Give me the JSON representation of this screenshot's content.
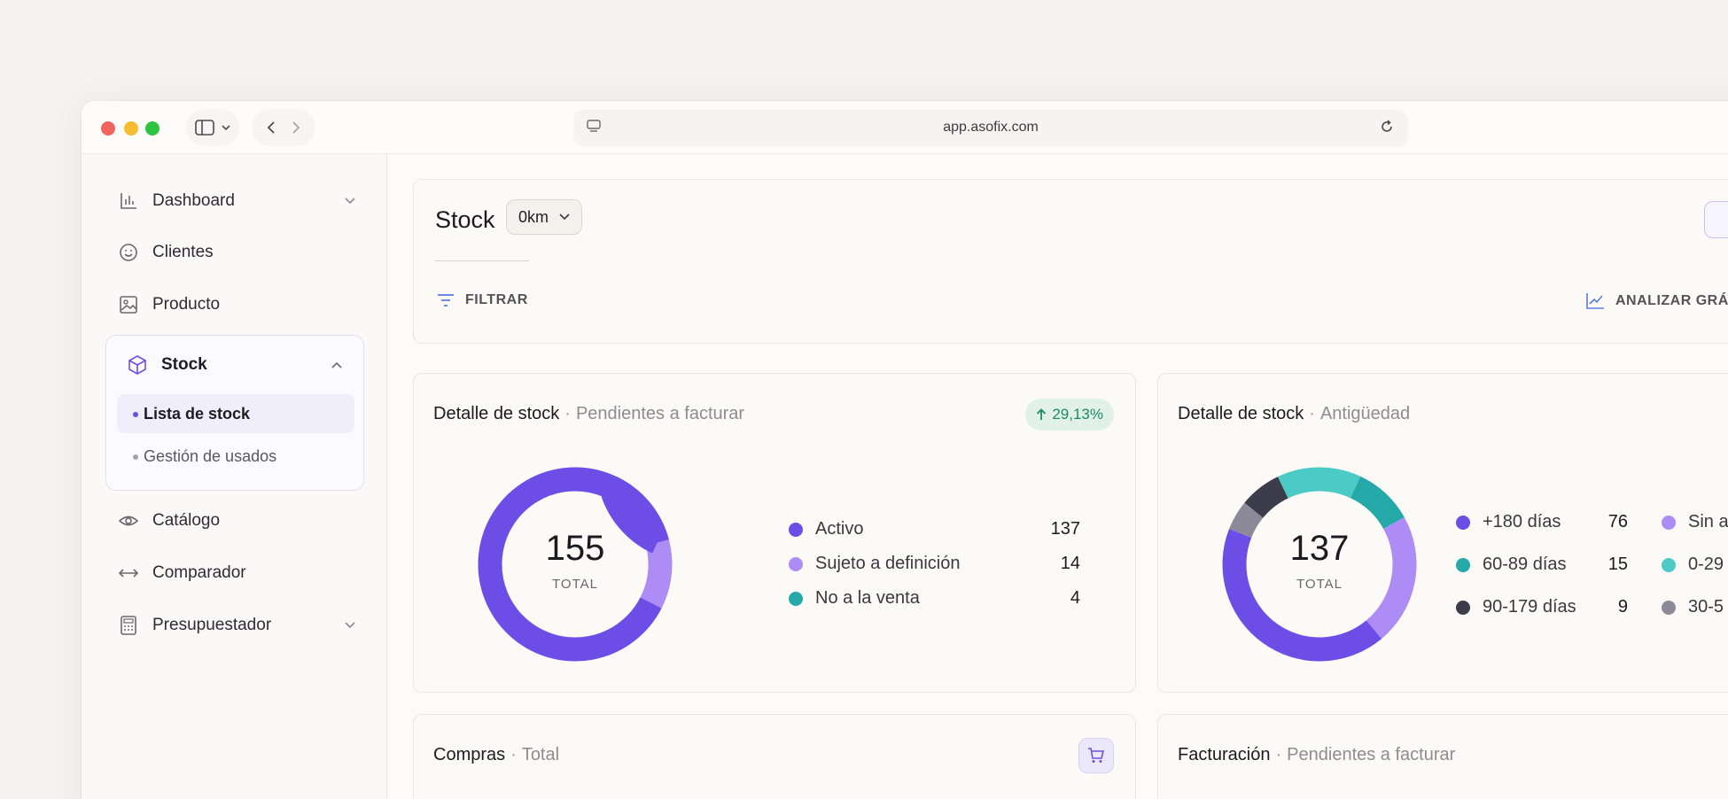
{
  "browser": {
    "url": "app.asofix.com"
  },
  "colors": {
    "purple": "#6c4ee6",
    "lilac": "#ad8cf6",
    "teal": "#24a9a8",
    "aqua": "#4ccac6",
    "dark": "#3d3c4b",
    "grey": "#8c8a99",
    "green_badge": "#1e8a62"
  },
  "sidebar": {
    "items": [
      {
        "label": "Dashboard",
        "icon": "bar-chart-icon"
      },
      {
        "label": "Clientes",
        "icon": "smiley-icon"
      },
      {
        "label": "Producto",
        "icon": "image-icon"
      },
      {
        "label": "Stock",
        "icon": "box-icon"
      },
      {
        "label": "Catálogo",
        "icon": "eye-icon"
      },
      {
        "label": "Comparador",
        "icon": "arrows-horizontal-icon"
      },
      {
        "label": "Presupuestador",
        "icon": "calculator-icon"
      }
    ],
    "stock_sub": [
      {
        "label": "Lista de stock"
      },
      {
        "label": "Gestión de usados"
      }
    ]
  },
  "header": {
    "title": "Stock",
    "select_value": "0km",
    "filter_label": "FILTRAR",
    "analyze_label": "ANALIZAR GRÁ"
  },
  "card1": {
    "title": "Detalle de stock",
    "sep": "·",
    "subtitle": "Pendientes a facturar",
    "badge": "29,13%",
    "total": "155",
    "total_label": "TOTAL"
  },
  "card2": {
    "title": "Detalle de stock",
    "sep": "·",
    "subtitle": "Antigüedad",
    "total": "137",
    "total_label": "TOTAL"
  },
  "card3": {
    "title": "Compras",
    "sep": "·",
    "subtitle": "Total"
  },
  "card4": {
    "title": "Facturación",
    "sep": "·",
    "subtitle": "Pendientes a facturar"
  },
  "chart_data": [
    {
      "type": "pie",
      "title": "",
      "categories": [
        "Activo",
        "Sujeto a definición",
        "No a la venta"
      ],
      "values": [
        137,
        14,
        4
      ],
      "colors": [
        "#6c4ee6",
        "#ad8cf6",
        "#24a9a8"
      ]
    },
    {
      "type": "pie",
      "title": "",
      "categories": [
        "+180 días",
        "60-89 días",
        "90-179 días",
        "Sin a",
        "0-29",
        "30-5"
      ],
      "values": [
        76,
        15,
        9,
        null,
        null,
        null
      ],
      "legend_values": [
        "76",
        "15",
        "9",
        "",
        "",
        ""
      ],
      "colors": [
        "#6c4ee6",
        "#24a9a8",
        "#3d3c4b",
        "#ad8cf6",
        "#4ccac6",
        "#8c8a99"
      ]
    }
  ]
}
